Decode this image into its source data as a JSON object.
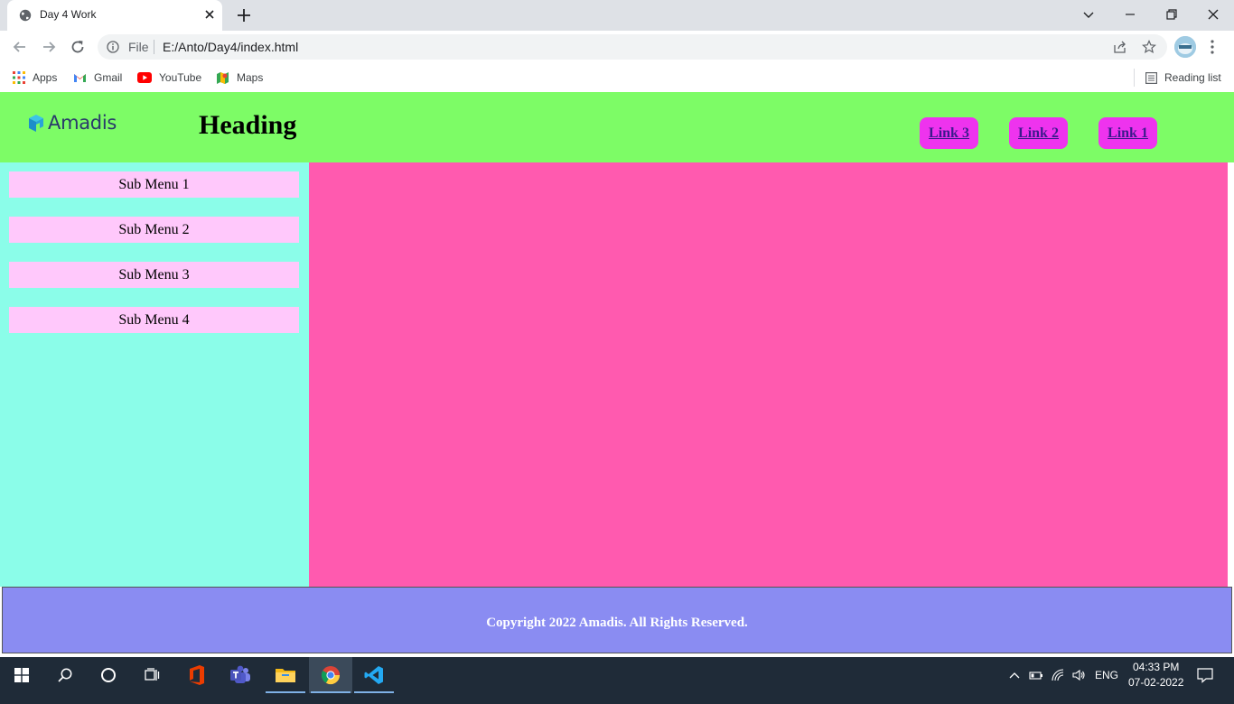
{
  "browser": {
    "tab_title": "Day 4 Work",
    "url_scheme": "File",
    "url": "E:/Anto/Day4/index.html",
    "bookmarks": [
      "Apps",
      "Gmail",
      "YouTube",
      "Maps"
    ],
    "reading_list": "Reading list"
  },
  "page": {
    "logo_text": "Amadis",
    "heading": "Heading",
    "nav_links": [
      "Link 3",
      "Link 2",
      "Link 1"
    ],
    "submenus": [
      "Sub Menu 1",
      "Sub Menu 2",
      "Sub Menu 3",
      "Sub Menu 4"
    ],
    "footer": "Copyright 2022 Amadis. All Rights Reserved.",
    "colors": {
      "header": "#7dfc66",
      "sidebar": "#8bfde9",
      "submenu": "#ffc8fb",
      "main": "#ff5aaf",
      "footer": "#8a8cf2",
      "nav_link": "#ee33ee"
    }
  },
  "taskbar": {
    "language": "ENG",
    "time": "04:33 PM",
    "date": "07-02-2022",
    "apps": [
      "windows-start-icon",
      "search-icon",
      "cortana-icon",
      "task-view-icon",
      "office-icon",
      "teams-icon",
      "file-explorer-icon",
      "chrome-icon",
      "vscode-icon"
    ]
  }
}
